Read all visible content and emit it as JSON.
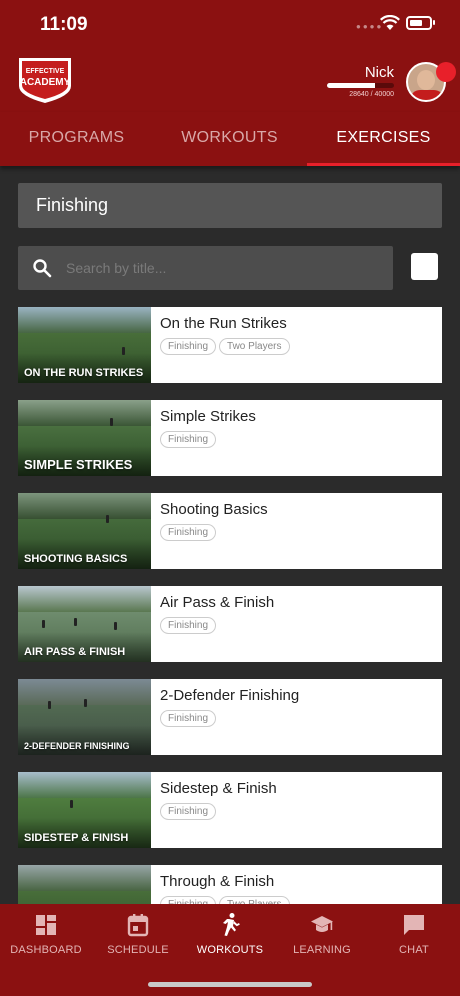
{
  "status_bar": {
    "time": "11:09"
  },
  "header": {
    "logo": {
      "line1": "EFFECTIVE",
      "line2": "ACADEMY"
    },
    "user_name": "Nick",
    "xp_text": "28640 / 40000",
    "xp_progress": 0.716
  },
  "tabs": [
    {
      "label": "PROGRAMS",
      "active": false
    },
    {
      "label": "WORKOUTS",
      "active": false
    },
    {
      "label": "EXERCISES",
      "active": true
    }
  ],
  "category": {
    "label": "Finishing"
  },
  "search": {
    "placeholder": "Search by title..."
  },
  "exercises": [
    {
      "title": "On the Run Strikes",
      "thumb_label": "ON THE RUN STRIKES",
      "tags": [
        "Finishing",
        "Two Players"
      ]
    },
    {
      "title": "Simple Strikes",
      "thumb_label": "SIMPLE STRIKES",
      "tags": [
        "Finishing"
      ]
    },
    {
      "title": "Shooting Basics",
      "thumb_label": "SHOOTING BASICS",
      "tags": [
        "Finishing"
      ]
    },
    {
      "title": "Air Pass & Finish",
      "thumb_label": "AIR PASS & FINISH",
      "tags": [
        "Finishing"
      ]
    },
    {
      "title": "2-Defender Finishing",
      "thumb_label": "2-DEFENDER FINISHING",
      "tags": [
        "Finishing"
      ]
    },
    {
      "title": "Sidestep & Finish",
      "thumb_label": "SIDESTEP & FINISH",
      "tags": [
        "Finishing"
      ]
    },
    {
      "title": "Through & Finish",
      "thumb_label": "",
      "tags": [
        "Finishing",
        "Two Players"
      ]
    }
  ],
  "bottom_nav": [
    {
      "label": "DASHBOARD",
      "icon": "dashboard-icon",
      "active": false
    },
    {
      "label": "SCHEDULE",
      "icon": "calendar-icon",
      "active": false
    },
    {
      "label": "WORKOUTS",
      "icon": "running-icon",
      "active": true
    },
    {
      "label": "LEARNING",
      "icon": "graduation-cap-icon",
      "active": false
    },
    {
      "label": "CHAT",
      "icon": "chat-icon",
      "active": false
    }
  ],
  "colors": {
    "brand_red": "#8b1111",
    "accent_red": "#e8202a",
    "background": "#2b2b2b",
    "field_green": "#3f6b34"
  }
}
